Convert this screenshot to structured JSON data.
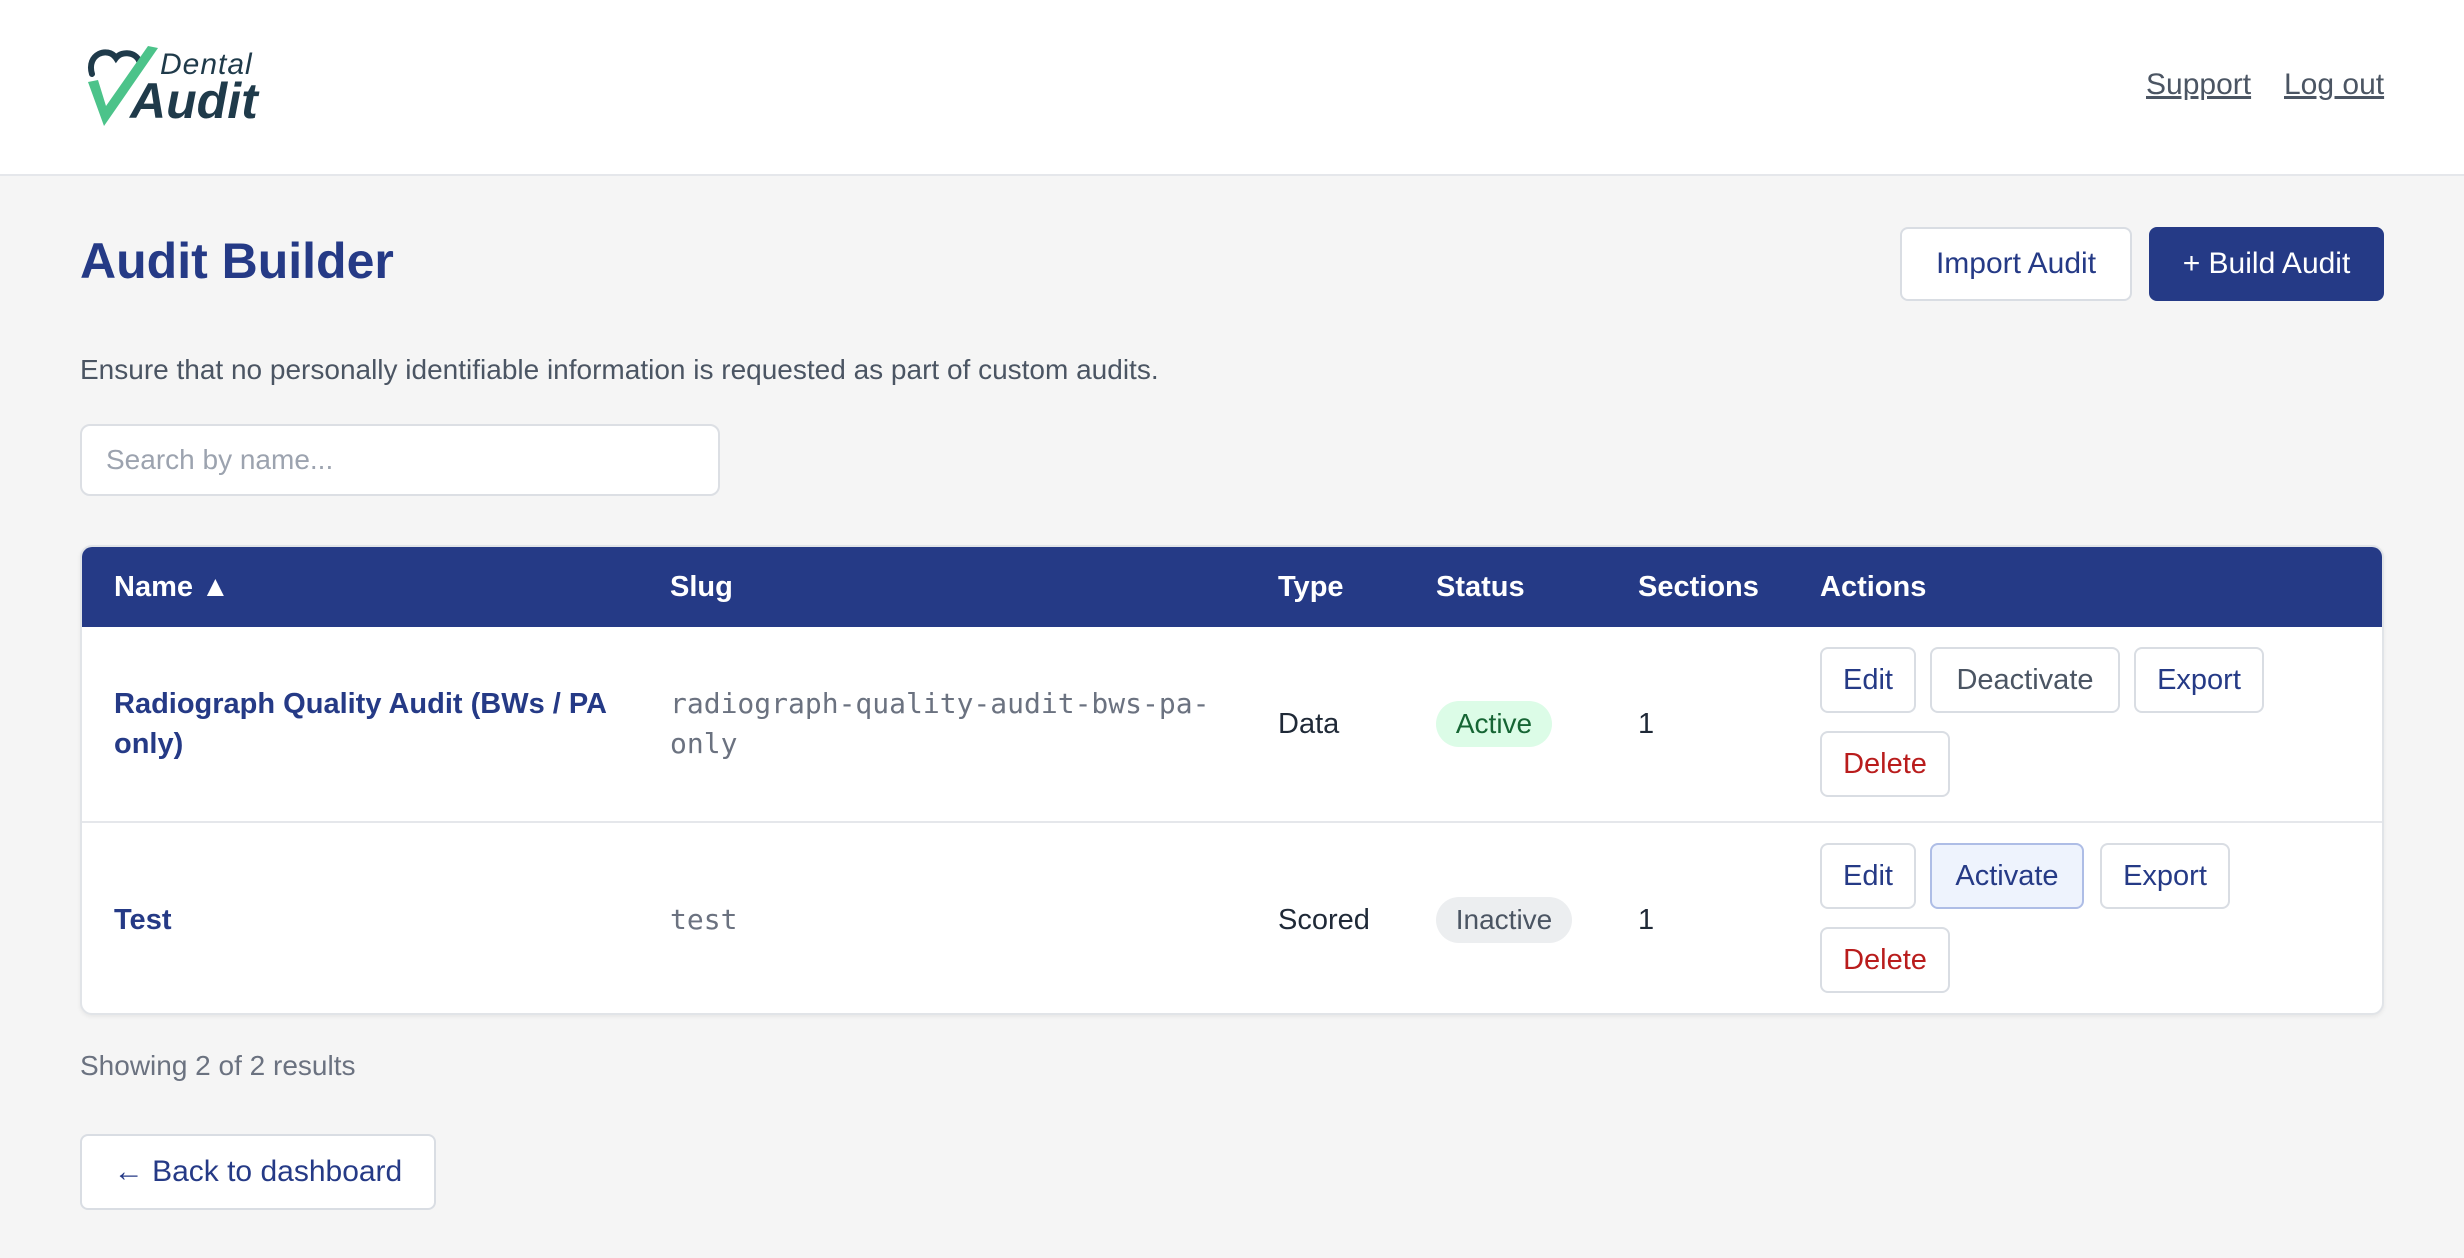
{
  "brand": {
    "small": "Dental",
    "big": "Audit"
  },
  "header": {
    "support": "Support",
    "logout": "Log out"
  },
  "page": {
    "title": "Audit Builder",
    "import_label": "Import Audit",
    "build_label": "+ Build Audit",
    "notice": "Ensure that no personally identifiable information is requested as part of custom audits."
  },
  "search": {
    "placeholder": "Search by name...",
    "value": ""
  },
  "table": {
    "columns": [
      "Name ▲",
      "Slug",
      "Type",
      "Status",
      "Sections",
      "Actions"
    ],
    "rows": [
      {
        "name_line1": "Radiograph Quality Audit (BWs / PA",
        "name_line2": "only)",
        "slug_line1": "radiograph-quality-audit-bws-pa-",
        "slug_line2": "only",
        "type": "Data",
        "status": "Active",
        "sections": "1",
        "actions": [
          "Edit",
          "Deactivate",
          "Export",
          "Delete"
        ]
      },
      {
        "name": "Test",
        "slug": "test",
        "type": "Scored",
        "status": "Inactive",
        "sections": "1",
        "actions": [
          "Edit",
          "Activate",
          "Export",
          "Delete"
        ]
      }
    ]
  },
  "results_text": "Showing 2 of 2 results",
  "back_label": "← Back to dashboard",
  "colors": {
    "primary": "#253a86",
    "logo_check": "#4cc38a",
    "active_bg": "#dcfce7",
    "danger": "#b91c1c"
  }
}
